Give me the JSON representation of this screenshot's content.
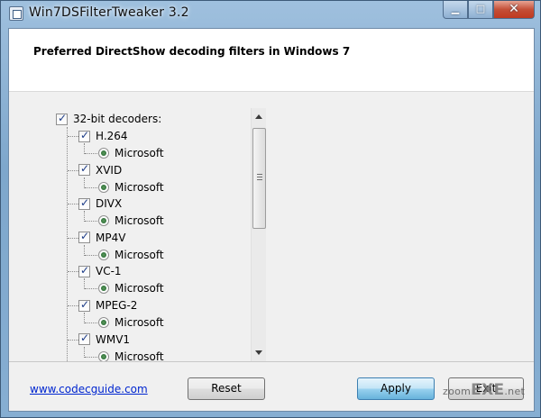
{
  "window": {
    "title": "Win7DSFilterTweaker 3.2",
    "caption": {
      "minimize": "▁",
      "maximize": "□",
      "close": "✕"
    }
  },
  "header": {
    "heading": "Preferred DirectShow decoding filters in Windows 7"
  },
  "tree": {
    "root": "32-bit decoders:",
    "codecs": [
      {
        "name": "H.264",
        "decoder": "Microsoft"
      },
      {
        "name": "XVID",
        "decoder": "Microsoft"
      },
      {
        "name": "DIVX",
        "decoder": "Microsoft"
      },
      {
        "name": "MP4V",
        "decoder": "Microsoft"
      },
      {
        "name": "VC-1",
        "decoder": "Microsoft"
      },
      {
        "name": "MPEG-2",
        "decoder": "Microsoft"
      },
      {
        "name": "WMV1",
        "decoder": "Microsoft"
      }
    ]
  },
  "footer": {
    "link": "www.codecguide.com",
    "reset_label": "Reset",
    "apply_label": "Apply",
    "exit_label": "Exit"
  },
  "watermark": {
    "prefix": "zoom",
    "brand": "EXE",
    "suffix": ".net"
  },
  "icons": [
    "app-icon",
    "checkbox-icon",
    "radio-icon",
    "scroll-up-arrow-icon",
    "scroll-down-arrow-icon"
  ]
}
